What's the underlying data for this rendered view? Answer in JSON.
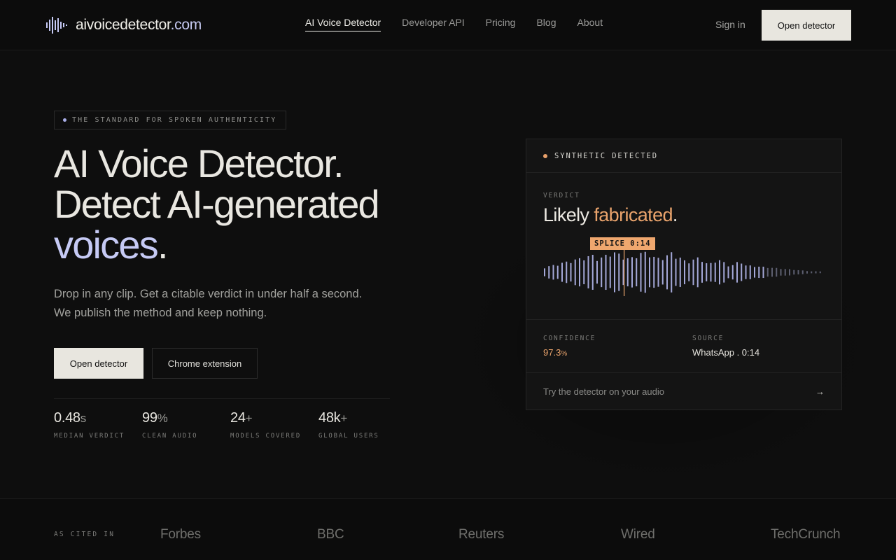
{
  "nav": {
    "logo_name": "aivoicedetector",
    "logo_tld": ".com",
    "links": [
      {
        "label": "AI Voice Detector",
        "active": true
      },
      {
        "label": "Developer API",
        "active": false
      },
      {
        "label": "Pricing",
        "active": false
      },
      {
        "label": "Blog",
        "active": false
      },
      {
        "label": "About",
        "active": false
      }
    ],
    "signin_label": "Sign in",
    "cta_label": "Open detector"
  },
  "hero": {
    "eyebrow": "THE STANDARD FOR SPOKEN AUTHENTICITY",
    "headline_line1": "AI Voice Detector.",
    "headline_line2": "Detect AI-generated",
    "headline_accent": "voices",
    "headline_end": ".",
    "subtitle_line1": "Drop in any clip. Get a citable verdict in under half a second.",
    "subtitle_line2": "We publish the method and keep nothing.",
    "primary_button": "Open detector",
    "secondary_button": "Chrome extension",
    "stats": [
      {
        "value": "0.48",
        "unit": "s",
        "label": "MEDIAN VERDICT"
      },
      {
        "value": "99",
        "unit": "%",
        "label": "CLEAN AUDIO"
      },
      {
        "value": "24",
        "unit": "+",
        "label": "MODELS COVERED"
      },
      {
        "value": "48k",
        "unit": "+",
        "label": "GLOBAL USERS"
      }
    ]
  },
  "card": {
    "status": "SYNTHETIC DETECTED",
    "verdict_label": "VERDICT",
    "verdict_prefix": "Likely ",
    "verdict_word": "fabricated",
    "verdict_end": ".",
    "splice_tag": "SPLICE 0:14",
    "confidence_label": "CONFIDENCE",
    "confidence_value": "97.3",
    "confidence_unit": "%",
    "source_label": "SOURCE",
    "source_value": "WhatsApp . 0:14",
    "try_text": "Try the detector on your audio",
    "try_arrow": "→"
  },
  "cited": {
    "label": "AS CITED IN",
    "outlets": [
      "Forbes",
      "BBC",
      "Reuters",
      "Wired",
      "TechCrunch"
    ]
  },
  "colors": {
    "background": "#0e0e0e",
    "accent_lavender": "#c6caf5",
    "accent_orange": "#efa76e",
    "button_light": "#e8e6df"
  }
}
